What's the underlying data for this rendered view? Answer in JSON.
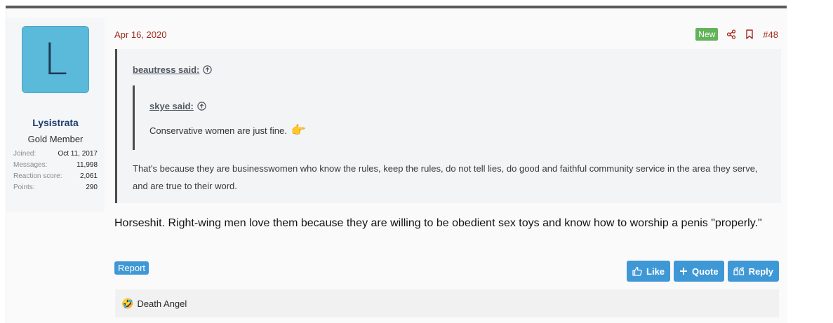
{
  "user": {
    "avatar_letter": "L",
    "name": "Lysistrata",
    "title": "Gold Member",
    "stats": [
      {
        "label": "Joined:",
        "value": "Oct 11, 2017"
      },
      {
        "label": "Messages:",
        "value": "11,998"
      },
      {
        "label": "Reaction score:",
        "value": "2,061"
      },
      {
        "label": "Points:",
        "value": "290"
      }
    ]
  },
  "post": {
    "date": "Apr 16, 2020",
    "badge": "New",
    "number": "#48",
    "quote_outer": {
      "author": "beautress said:",
      "text": "That's because they are businesswomen who know the rules, keep the rules, do not tell lies, do good and faithful community service in the area they serve, and are true to their word."
    },
    "quote_inner": {
      "author": "skye said:",
      "text": "Conservative women are just fine.",
      "emoji": "👉"
    },
    "body": "Horseshit. Right-wing men love them because they are willing to be obedient sex toys and know how to worship a penis \"properly.\"",
    "report_label": "Report",
    "buttons": {
      "like": "Like",
      "quote": "Quote",
      "reply": "Reply"
    },
    "reactions": {
      "emoji": "🤣",
      "users": "Death Angel"
    }
  },
  "icons": [
    "share-icon",
    "bookmark-icon",
    "up-arrow-circle-icon",
    "thumbs-up-icon",
    "plus-icon",
    "quote-marks-icon"
  ],
  "colors": {
    "accent": "#3f98d6",
    "date": "#a02a1b",
    "new_badge": "#63b35a",
    "avatar": "#5bb9d9"
  }
}
